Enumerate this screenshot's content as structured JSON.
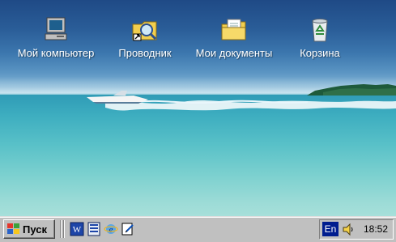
{
  "desktop": {
    "icons": [
      {
        "label": "Мой компьютер",
        "icon": "my-computer-icon"
      },
      {
        "label": "Проводник",
        "icon": "explorer-icon"
      },
      {
        "label": "Мои документы",
        "icon": "my-documents-icon"
      },
      {
        "label": "Корзина",
        "icon": "recycle-bin-icon"
      }
    ]
  },
  "taskbar": {
    "start_label": "Пуск",
    "quick_launch": [
      "word-icon",
      "office-icon",
      "internet-explorer-icon",
      "notepad-icon"
    ],
    "tray": {
      "language": "En",
      "clock": "18:52"
    }
  }
}
